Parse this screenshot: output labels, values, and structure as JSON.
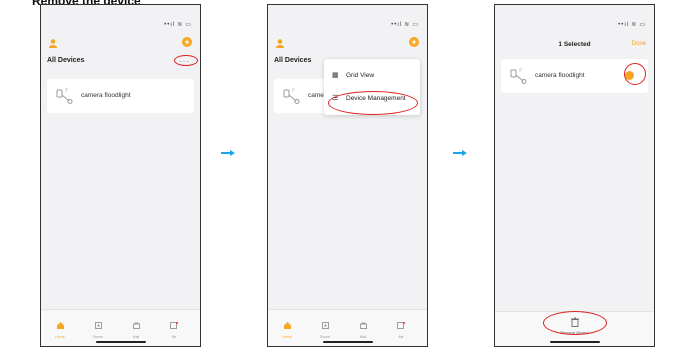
{
  "heading": "Remove the device",
  "status": {
    "signal": "••ıl",
    "wifi": "≋",
    "battery": "▭"
  },
  "home": {
    "section_title": "All Devices",
    "more_label": "···",
    "device_name": "camera floodlight",
    "device_name_truncated": "came"
  },
  "menu": {
    "items": [
      {
        "label": "Grid View",
        "icon": "grid-icon"
      },
      {
        "label": "Device Management",
        "icon": "list-icon"
      }
    ]
  },
  "manage": {
    "selected_title": "1 Selected",
    "done_label": "Done",
    "remove_label": "Remove Device"
  },
  "tabs": [
    {
      "label": "Home",
      "icon": "home-icon"
    },
    {
      "label": "Scene",
      "icon": "scene-icon"
    },
    {
      "label": "Mall",
      "icon": "mall-icon"
    },
    {
      "label": "Me",
      "icon": "me-icon"
    }
  ],
  "colors": {
    "accent": "#f5a623",
    "highlight": "#dd2222",
    "arrow": "#1aa3e8"
  }
}
